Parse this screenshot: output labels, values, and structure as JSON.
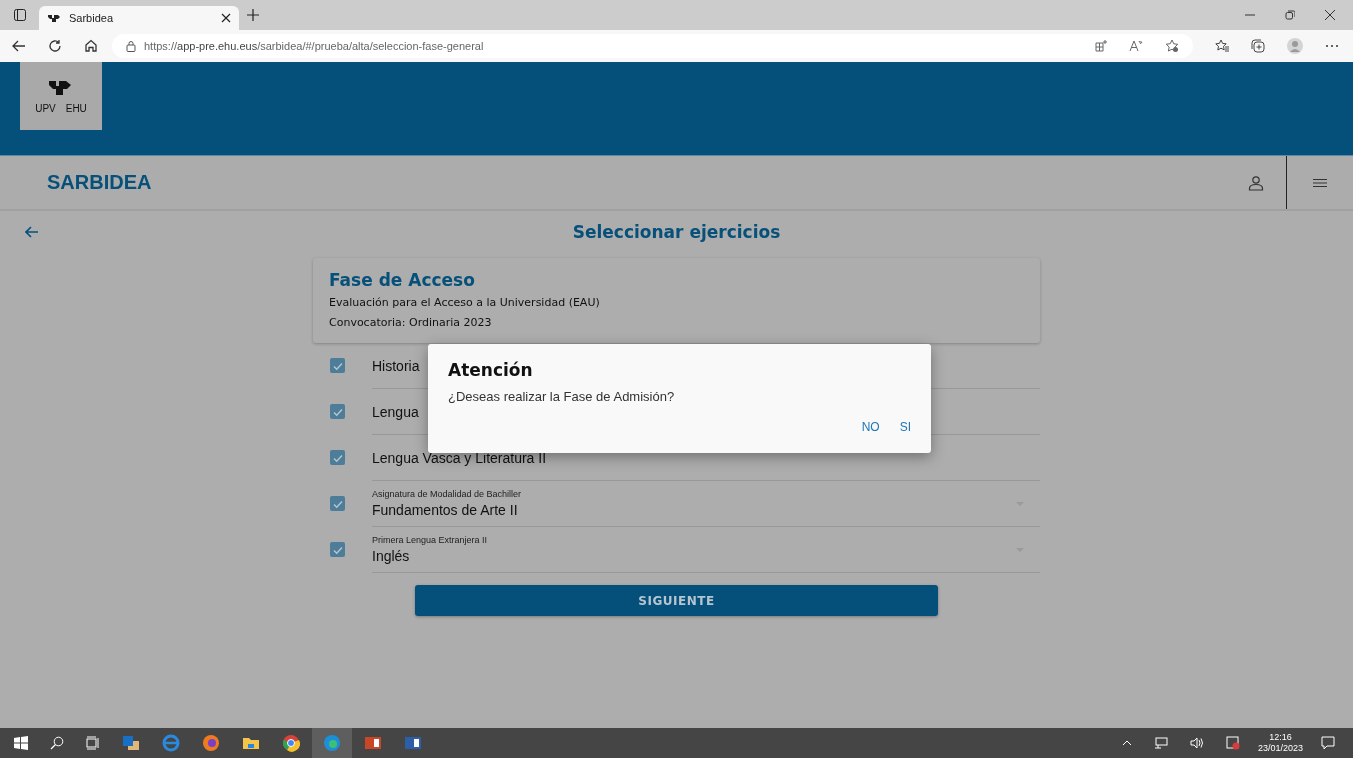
{
  "browser": {
    "tab_title": "Sarbidea",
    "url_scheme": "https://",
    "url_host": "app-pre.ehu.eus",
    "url_path": "/sarbidea/#/prueba/alta/seleccion-fase-general"
  },
  "header": {
    "logo_left": "UPV",
    "logo_right": "EHU"
  },
  "app_bar": {
    "title": "SARBIDEA"
  },
  "page": {
    "title": "Seleccionar ejercicios"
  },
  "card": {
    "title": "Fase de Acceso",
    "line_1": "Evaluación para el Acceso a la Universidad (EAU)",
    "line_2": "Convocatoria: Ordinaria 2023"
  },
  "exercises": [
    {
      "kind": "plain",
      "text": "Historia",
      "checked": true
    },
    {
      "kind": "plain",
      "text": "Lengua",
      "checked": true
    },
    {
      "kind": "plain",
      "text": "Lengua Vasca y Literatura II",
      "checked": true
    },
    {
      "kind": "select",
      "label": "Asignatura de Modalidad de Bachiller",
      "text": "Fundamentos de Arte II",
      "checked": true
    },
    {
      "kind": "select",
      "label": "Primera Lengua Extranjera II",
      "text": "Inglés",
      "checked": true
    }
  ],
  "next_button": "SIGUIENTE",
  "dialog": {
    "title": "Atención",
    "message": "¿Deseas realizar la Fase de Admisión?",
    "buttons": [
      "NO",
      "SI"
    ]
  },
  "taskbar": {
    "time": "12:16",
    "date": "23/01/2023"
  }
}
